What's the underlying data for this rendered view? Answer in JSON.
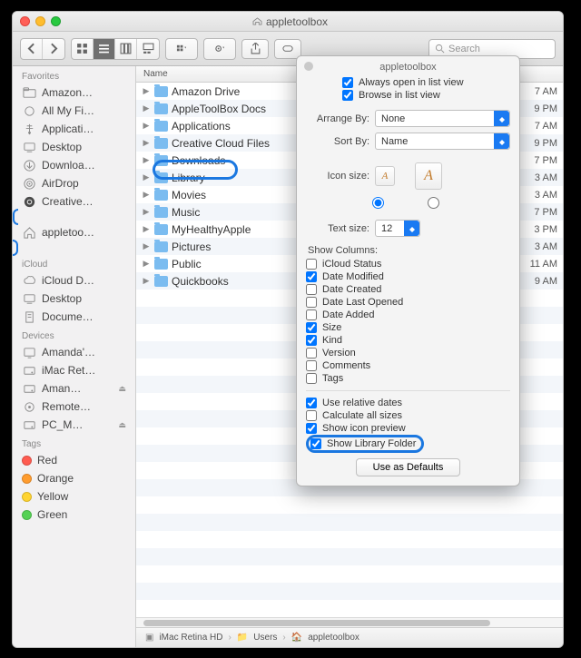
{
  "window": {
    "title": "appletoolbox"
  },
  "toolbar": {
    "search_placeholder": "Search"
  },
  "sidebar": {
    "sections": [
      {
        "head": "Favorites",
        "items": [
          {
            "label": "Amazon…",
            "icon": "folder"
          },
          {
            "label": "All My Fi…",
            "icon": "smart"
          },
          {
            "label": "Applicati…",
            "icon": "apps"
          },
          {
            "label": "Desktop",
            "icon": "desktop"
          },
          {
            "label": "Downloa…",
            "icon": "download"
          },
          {
            "label": "AirDrop",
            "icon": "airdrop"
          },
          {
            "label": "Creative…",
            "icon": "cc"
          },
          {
            "label": "appletoo…",
            "icon": "home",
            "annot": true
          }
        ]
      },
      {
        "head": "iCloud",
        "items": [
          {
            "label": "iCloud D…",
            "icon": "cloud"
          },
          {
            "label": "Desktop",
            "icon": "desktop"
          },
          {
            "label": "Docume…",
            "icon": "doc"
          }
        ]
      },
      {
        "head": "Devices",
        "items": [
          {
            "label": "Amanda'…",
            "icon": "mac"
          },
          {
            "label": "iMac Ret…",
            "icon": "disk"
          },
          {
            "label": "Aman…",
            "icon": "disk",
            "eject": true
          },
          {
            "label": "Remote…",
            "icon": "remote"
          },
          {
            "label": "PC_M…",
            "icon": "disk",
            "eject": true
          }
        ]
      },
      {
        "head": "Tags",
        "items": [
          {
            "label": "Red",
            "icon": "tag",
            "color": "#ff5b50"
          },
          {
            "label": "Orange",
            "icon": "tag",
            "color": "#ff9c2e"
          },
          {
            "label": "Yellow",
            "icon": "tag",
            "color": "#ffd431"
          },
          {
            "label": "Green",
            "icon": "tag",
            "color": "#55d154"
          }
        ]
      }
    ]
  },
  "list": {
    "name_header": "Name",
    "rows": [
      {
        "name": "Amazon Drive",
        "date": "7 AM"
      },
      {
        "name": "AppleToolBox Docs",
        "date": "9 PM"
      },
      {
        "name": "Applications",
        "date": "7 AM"
      },
      {
        "name": "Creative Cloud Files",
        "date": "9 PM"
      },
      {
        "name": "Downloads",
        "date": "7 PM"
      },
      {
        "name": "Library",
        "date": "3 AM"
      },
      {
        "name": "Movies",
        "date": "3 AM"
      },
      {
        "name": "Music",
        "date": "7 PM"
      },
      {
        "name": "MyHealthyApple",
        "date": "3 PM"
      },
      {
        "name": "Pictures",
        "date": "3 AM"
      },
      {
        "name": "Public",
        "date": "11 AM"
      },
      {
        "name": "Quickbooks",
        "date": "9 AM"
      }
    ]
  },
  "pathbar": {
    "a": "iMac Retina HD",
    "b": "Users",
    "c": "appletoolbox"
  },
  "popover": {
    "title": "appletoolbox",
    "always_list": "Always open in list view",
    "browse_list": "Browse in list view",
    "arrange_by": "Arrange By:",
    "arrange_val": "None",
    "sort_by": "Sort By:",
    "sort_val": "Name",
    "icon_size": "Icon size:",
    "text_size": "Text size:",
    "text_val": "12",
    "show_cols": "Show Columns:",
    "cols": [
      {
        "label": "iCloud Status",
        "chk": false
      },
      {
        "label": "Date Modified",
        "chk": true
      },
      {
        "label": "Date Created",
        "chk": false
      },
      {
        "label": "Date Last Opened",
        "chk": false
      },
      {
        "label": "Date Added",
        "chk": false
      },
      {
        "label": "Size",
        "chk": true
      },
      {
        "label": "Kind",
        "chk": true
      },
      {
        "label": "Version",
        "chk": false
      },
      {
        "label": "Comments",
        "chk": false
      },
      {
        "label": "Tags",
        "chk": false
      }
    ],
    "use_relative": "Use relative dates",
    "calc_all": "Calculate all sizes",
    "icon_preview": "Show icon preview",
    "show_library": "Show Library Folder",
    "defaults": "Use as Defaults"
  }
}
